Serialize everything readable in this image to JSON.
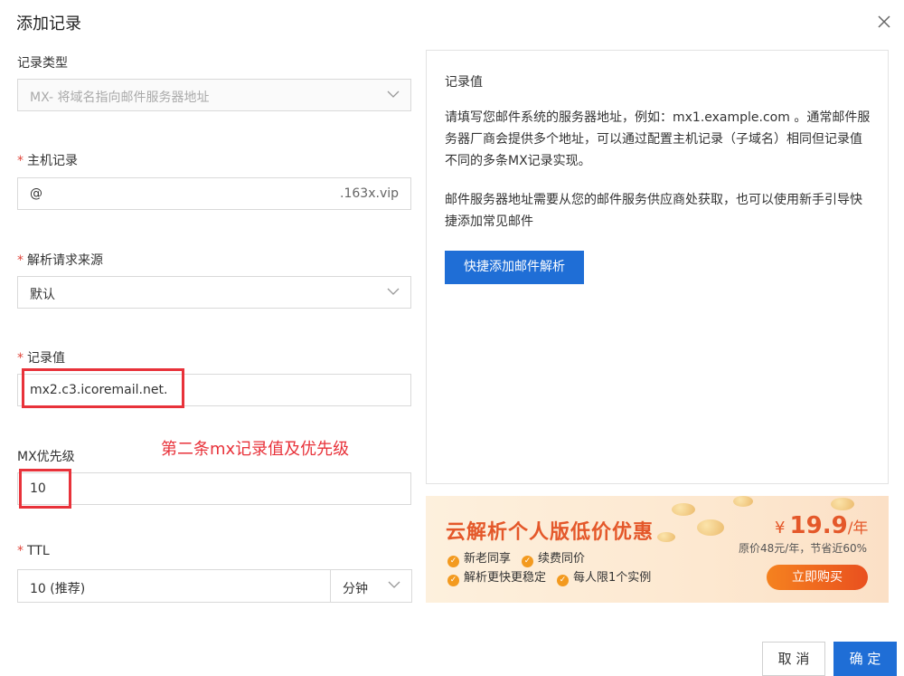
{
  "dialog": {
    "title": "添加记录"
  },
  "form": {
    "record_type": {
      "label": "记录类型",
      "value": "MX- 将域名指向邮件服务器地址"
    },
    "host": {
      "label": "主机记录",
      "value": "@",
      "suffix": ".163x.vip"
    },
    "resolve_source": {
      "label": "解析请求来源",
      "value": "默认"
    },
    "record_value": {
      "label": "记录值",
      "value": "mx2.c3.icoremail.net."
    },
    "mx_priority": {
      "label": "MX优先级",
      "value": "10"
    },
    "ttl": {
      "label": "TTL",
      "value": "10 (推荐)",
      "unit": "分钟"
    },
    "required_mark": "*"
  },
  "annotation": {
    "text": "第二条mx记录值及优先级",
    "color": "#e8323a"
  },
  "help_panel": {
    "title": "记录值",
    "paragraph1": "请填写您邮件系统的服务器地址，例如：mx1.example.com 。通常邮件服务器厂商会提供多个地址，可以通过配置主机记录（子域名）相同但记录值不同的多条MX记录实现。",
    "paragraph2": "邮件服务器地址需要从您的邮件服务供应商处获取，也可以使用新手引导快捷添加常见邮件",
    "button": "快捷添加邮件解析"
  },
  "promo": {
    "title": "云解析个人版低价优惠",
    "features": [
      "新老同享",
      "续费同价",
      "解析更快更稳定",
      "每人限1个实例"
    ],
    "price_symbol": "¥",
    "price": "19.9",
    "price_unit": "/年",
    "original": "原价48元/年，节省近60%",
    "button": "立即购买"
  },
  "footer": {
    "cancel": "取 消",
    "confirm": "确 定"
  },
  "colors": {
    "primary": "#1f6ed6",
    "accent": "#e4582a",
    "required": "#e0463b"
  },
  "icons": {
    "close": "close-icon",
    "dropdown": "chevron-down-icon",
    "check": "check-circle-icon"
  }
}
